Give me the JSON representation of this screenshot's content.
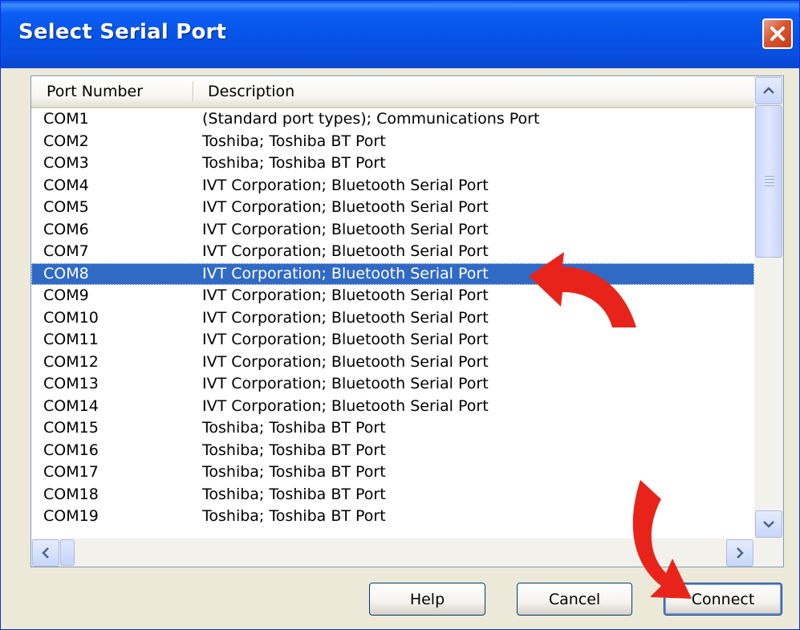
{
  "window": {
    "title": "Select Serial Port",
    "close_icon": "close-icon"
  },
  "list": {
    "columns": [
      "Port Number",
      "Description"
    ],
    "rows": [
      {
        "port": "COM1",
        "description": "(Standard port types); Communications Port"
      },
      {
        "port": "COM2",
        "description": "Toshiba; Toshiba BT Port"
      },
      {
        "port": "COM3",
        "description": "Toshiba; Toshiba BT Port"
      },
      {
        "port": "COM4",
        "description": "IVT Corporation; Bluetooth Serial Port"
      },
      {
        "port": "COM5",
        "description": "IVT Corporation; Bluetooth Serial Port"
      },
      {
        "port": "COM6",
        "description": "IVT Corporation; Bluetooth Serial Port"
      },
      {
        "port": "COM7",
        "description": "IVT Corporation; Bluetooth Serial Port"
      },
      {
        "port": "COM8",
        "description": "IVT Corporation; Bluetooth Serial Port"
      },
      {
        "port": "COM9",
        "description": "IVT Corporation; Bluetooth Serial Port"
      },
      {
        "port": "COM10",
        "description": "IVT Corporation; Bluetooth Serial Port"
      },
      {
        "port": "COM11",
        "description": "IVT Corporation; Bluetooth Serial Port"
      },
      {
        "port": "COM12",
        "description": "IVT Corporation; Bluetooth Serial Port"
      },
      {
        "port": "COM13",
        "description": "IVT Corporation; Bluetooth Serial Port"
      },
      {
        "port": "COM14",
        "description": "IVT Corporation; Bluetooth Serial Port"
      },
      {
        "port": "COM15",
        "description": "Toshiba; Toshiba BT Port"
      },
      {
        "port": "COM16",
        "description": "Toshiba; Toshiba BT Port"
      },
      {
        "port": "COM17",
        "description": "Toshiba; Toshiba BT Port"
      },
      {
        "port": "COM18",
        "description": "Toshiba; Toshiba BT Port"
      },
      {
        "port": "COM19",
        "description": "Toshiba; Toshiba BT Port"
      }
    ],
    "selected_port": "COM8"
  },
  "buttons": {
    "help": "Help",
    "cancel": "Cancel",
    "connect": "Connect"
  },
  "annotations": {
    "arrow_color": "#e8241a"
  },
  "colors": {
    "titlebar": "#0a4fe0",
    "selection": "#316ac5",
    "dialog_bg": "#ece9d8"
  }
}
